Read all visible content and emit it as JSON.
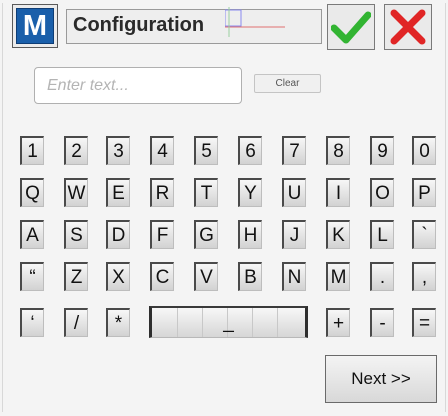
{
  "header": {
    "logo_letter": "M",
    "title": "Configuration",
    "ok_icon": "green-checkmark-icon",
    "cancel_icon": "red-x-icon",
    "ok_color": "#32b432",
    "cancel_color": "#e02525"
  },
  "input": {
    "value": "",
    "placeholder": "Enter text...",
    "clear_label": "Clear"
  },
  "keyboard": {
    "rows": [
      [
        "1",
        "2",
        "3",
        "4",
        "5",
        "6",
        "7",
        "8",
        "9",
        "0"
      ],
      [
        "Q",
        "W",
        "E",
        "R",
        "T",
        "Y",
        "U",
        "I",
        "O",
        "P"
      ],
      [
        "A",
        "S",
        "D",
        "F",
        "G",
        "H",
        "J",
        "K",
        "L",
        "`"
      ],
      [
        "“",
        "Z",
        "X",
        "C",
        "V",
        "B",
        "N",
        "M",
        ".",
        ","
      ]
    ],
    "bottom_left": [
      "‘",
      "/",
      "*"
    ],
    "space_label": "_",
    "bottom_right": [
      "+",
      "-",
      "="
    ]
  },
  "footer": {
    "next_label": "Next >>"
  }
}
